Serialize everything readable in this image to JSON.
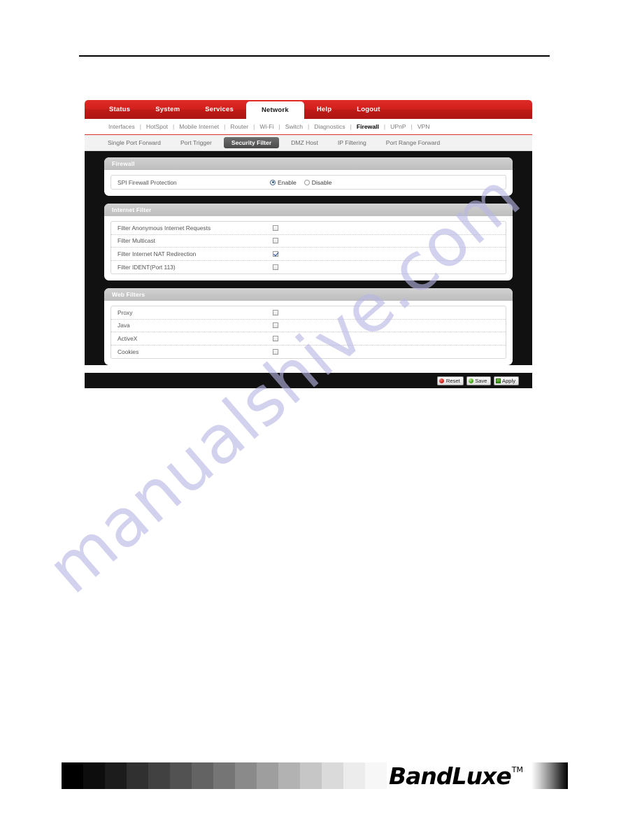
{
  "page": {
    "watermark": "manualshive.com"
  },
  "nav": {
    "main_tabs": [
      {
        "label": "Status",
        "active": false
      },
      {
        "label": "System",
        "active": false
      },
      {
        "label": "Services",
        "active": false
      },
      {
        "label": "Network",
        "active": true
      },
      {
        "label": "Help",
        "active": false
      },
      {
        "label": "Logout",
        "active": false
      }
    ],
    "sub_tabs": [
      {
        "label": "Interfaces",
        "active": false
      },
      {
        "label": "HotSpot",
        "active": false
      },
      {
        "label": "Mobile Internet",
        "active": false
      },
      {
        "label": "Router",
        "active": false
      },
      {
        "label": "Wi-Fi",
        "active": false
      },
      {
        "label": "Switch",
        "active": false
      },
      {
        "label": "Diagnostics",
        "active": false
      },
      {
        "label": "Firewall",
        "active": true
      },
      {
        "label": "UPnP",
        "active": false
      },
      {
        "label": "VPN",
        "active": false
      }
    ],
    "third_tabs": [
      {
        "label": "Single Port Forward",
        "active": false
      },
      {
        "label": "Port Trigger",
        "active": false
      },
      {
        "label": "Security Filter",
        "active": true
      },
      {
        "label": "DMZ Host",
        "active": false
      },
      {
        "label": "IP Filtering",
        "active": false
      },
      {
        "label": "Port Range Forward",
        "active": false
      }
    ]
  },
  "panels": {
    "firewall": {
      "title": "Firewall",
      "row_label": "SPI Firewall Protection",
      "options": [
        {
          "label": "Enable",
          "selected": true
        },
        {
          "label": "Disable",
          "selected": false
        }
      ]
    },
    "internet_filter": {
      "title": "Internet Filter",
      "rows": [
        {
          "label": "Filter Anonymous Internet Requests",
          "checked": false
        },
        {
          "label": "Filter Multicast",
          "checked": false
        },
        {
          "label": "Filter Internet NAT Redirection",
          "checked": true
        },
        {
          "label": "Filter IDENT(Port 113)",
          "checked": false
        }
      ]
    },
    "web_filters": {
      "title": "Web Filters",
      "rows": [
        {
          "label": "Proxy",
          "checked": false
        },
        {
          "label": "Java",
          "checked": false
        },
        {
          "label": "ActiveX",
          "checked": false
        },
        {
          "label": "Cookies",
          "checked": false
        }
      ]
    }
  },
  "footer_buttons": [
    {
      "label": "Reset",
      "icon": "reset-icon"
    },
    {
      "label": "Save",
      "icon": "save-icon"
    },
    {
      "label": "Apply",
      "icon": "apply-icon"
    }
  ],
  "brand": {
    "name": "BandLuxe",
    "trademark": "TM"
  },
  "grayscale": {
    "steps": [
      "#000000",
      "#0d0d0d",
      "#1c1c1c",
      "#303030",
      "#414141",
      "#525252",
      "#636363",
      "#757575",
      "#8a8a8a",
      "#9e9e9e",
      "#b2b2b2",
      "#c6c6c6",
      "#dadada",
      "#ececec",
      "#f7f7f7"
    ]
  },
  "colors": {
    "brand_red": "#cc1f1c",
    "panel_header_gray": "#c6c6c6",
    "body_black": "#111111",
    "accent_blue": "#2d5b8e",
    "watermark_purple": "#b9b7e4"
  }
}
